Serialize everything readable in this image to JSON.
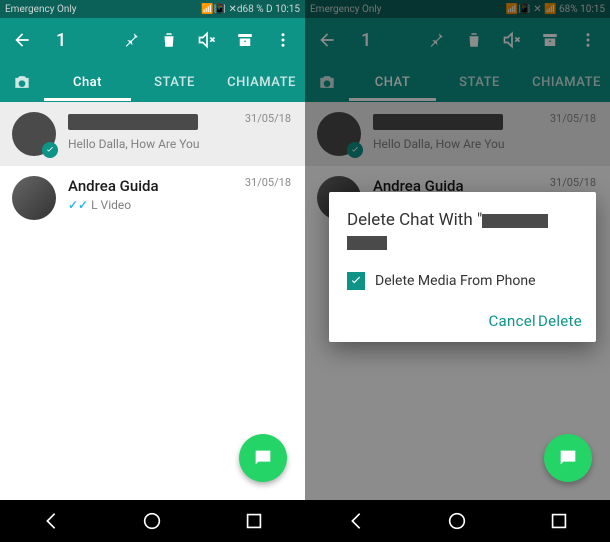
{
  "left": {
    "statusbar": {
      "left": "Emergency Only",
      "right": "📶📳 ✕d68 % D 10:15"
    },
    "actionbar": {
      "count": "1"
    },
    "tabs": {
      "chat": "Chat",
      "state": "STATE",
      "calls": "CHIAMATE"
    },
    "chats": [
      {
        "name_redacted": true,
        "preview": "Hello Dalla, How Are You",
        "date": "31/05/18",
        "selected": true
      },
      {
        "name": "Andrea Guida",
        "preview": "L Video",
        "date": "31/05/18",
        "ticks": true
      }
    ]
  },
  "right": {
    "statusbar": {
      "left": "Emergency Only",
      "right": "📶📳 ✕ 📶 68% 10:15"
    },
    "actionbar": {
      "count": "1"
    },
    "tabs": {
      "chat": "CHAT",
      "state": "STATE",
      "calls": "CHIAMATE"
    },
    "chats": [
      {
        "name_redacted": true,
        "preview": "Hello Dalla, How Are You",
        "date": "31/05/18",
        "selected": true
      },
      {
        "name": "Andrea Guida",
        "preview": "",
        "date": "31/05/18"
      }
    ],
    "dialog": {
      "title": "Delete Chat With \"",
      "checkbox_label": "Delete Media From Phone",
      "checked": true,
      "cancel": "Cancel",
      "delete": "Delete"
    }
  }
}
